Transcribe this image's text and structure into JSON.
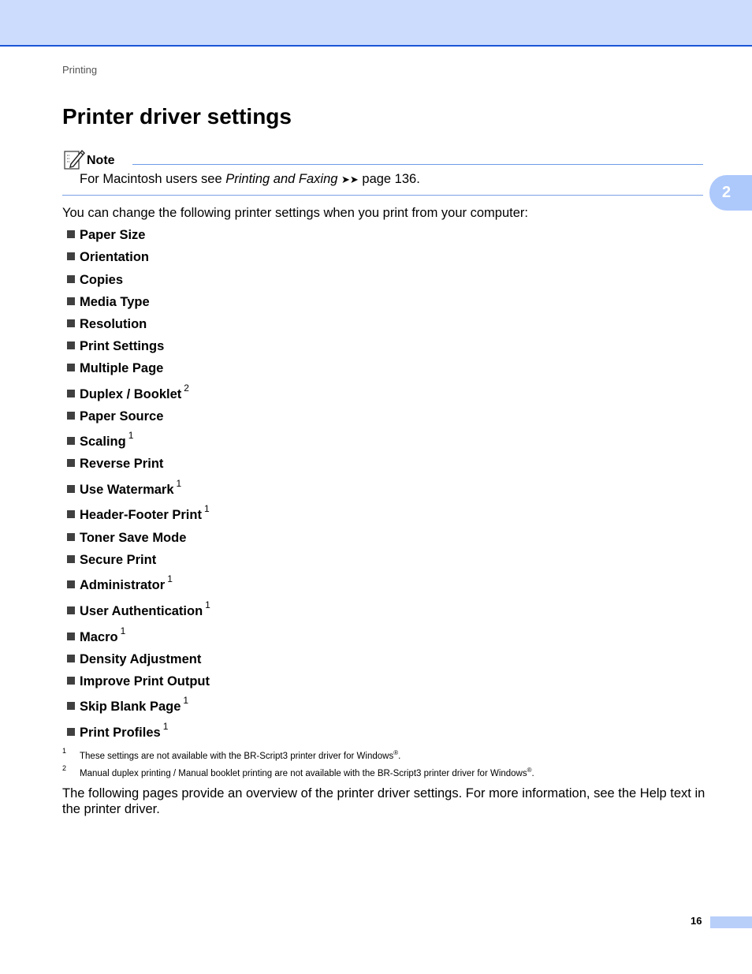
{
  "header": {
    "running_head": "Printing",
    "chapter_tab": "2"
  },
  "page_title": "Printer driver settings",
  "note": {
    "label": "Note",
    "text_before": "For Macintosh users see ",
    "text_italic": "Printing and Faxing",
    "text_arrows": "➤➤",
    "text_after": " page 136."
  },
  "intro": "You can change the following printer settings when you print from your computer:",
  "settings": [
    {
      "label": "Paper Size",
      "footnote": ""
    },
    {
      "label": "Orientation",
      "footnote": ""
    },
    {
      "label": "Copies",
      "footnote": ""
    },
    {
      "label": "Media Type",
      "footnote": ""
    },
    {
      "label": "Resolution",
      "footnote": ""
    },
    {
      "label": "Print Settings",
      "footnote": ""
    },
    {
      "label": "Multiple Page",
      "footnote": ""
    },
    {
      "label": "Duplex / Booklet",
      "footnote": "2"
    },
    {
      "label": "Paper Source",
      "footnote": ""
    },
    {
      "label": "Scaling",
      "footnote": "1"
    },
    {
      "label": "Reverse Print",
      "footnote": ""
    },
    {
      "label": "Use Watermark",
      "footnote": "1"
    },
    {
      "label": "Header-Footer Print",
      "footnote": "1"
    },
    {
      "label": "Toner Save Mode",
      "footnote": ""
    },
    {
      "label": "Secure Print",
      "footnote": ""
    },
    {
      "label": "Administrator",
      "footnote": "1"
    },
    {
      "label": "User Authentication",
      "footnote": "1"
    },
    {
      "label": "Macro",
      "footnote": "1"
    },
    {
      "label": "Density Adjustment",
      "footnote": ""
    },
    {
      "label": "Improve Print Output",
      "footnote": ""
    },
    {
      "label": "Skip Blank Page",
      "footnote": "1"
    },
    {
      "label": "Print Profiles",
      "footnote": "1"
    }
  ],
  "footnotes": [
    {
      "num": "1",
      "text": "These settings are not available with the BR-Script3 printer driver for Windows",
      "mark": "®",
      "end": "."
    },
    {
      "num": "2",
      "text": "Manual duplex printing / Manual booklet printing are not available with the BR-Script3 printer driver for Windows",
      "mark": "®",
      "end": "."
    }
  ],
  "outro": "The following pages provide an overview of the printer driver settings. For more information, see the Help text in the printer driver.",
  "footer": {
    "page_number": "16"
  }
}
